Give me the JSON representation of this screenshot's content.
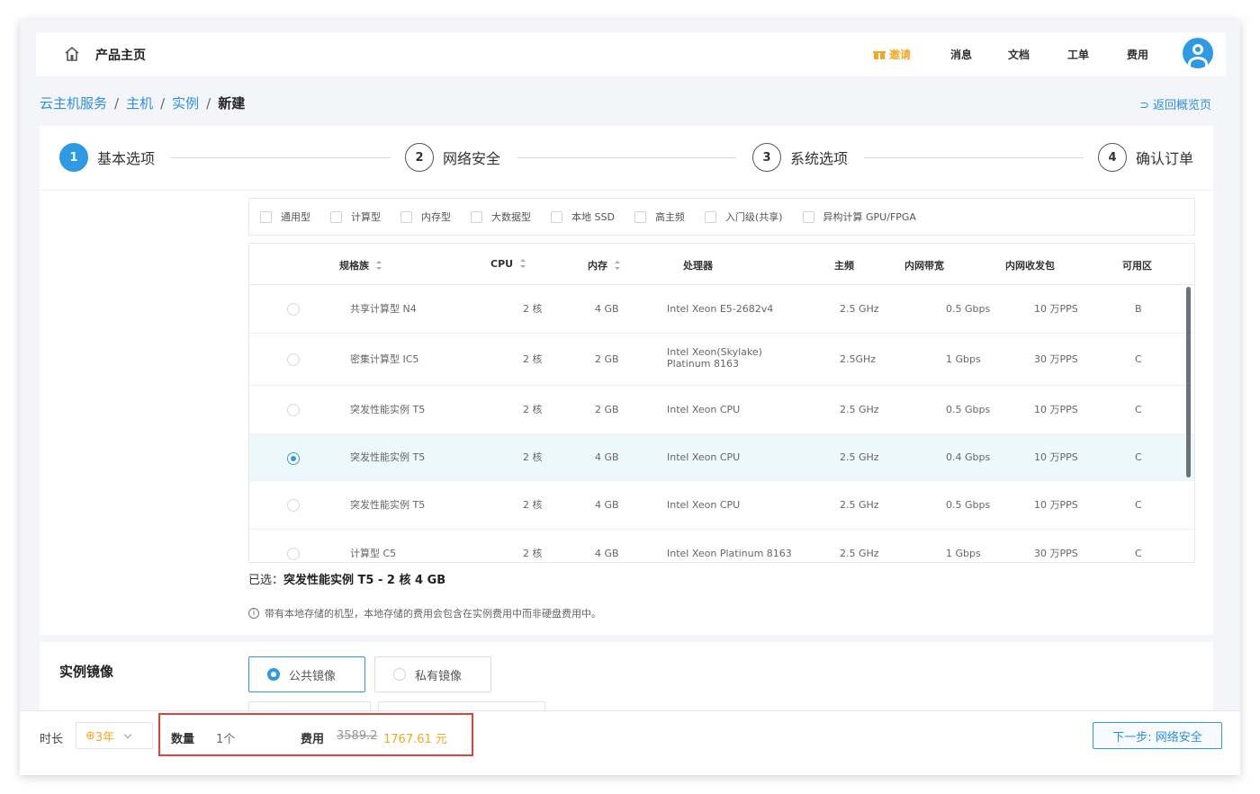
{
  "topnav": {
    "home_label": "产品主页",
    "promo_label": "邀请",
    "items": [
      "消息",
      "文档",
      "工单",
      "费用"
    ]
  },
  "breadcrumb": {
    "items": [
      "云主机服务",
      "主机",
      "实例"
    ],
    "current": "新建",
    "back_label": "返回概览页"
  },
  "steps": [
    {
      "num": "1",
      "label": "基本选项"
    },
    {
      "num": "2",
      "label": "网络安全"
    },
    {
      "num": "3",
      "label": "系统选项"
    },
    {
      "num": "4",
      "label": "确认订单"
    }
  ],
  "filters": [
    "通用型",
    "计算型",
    "内存型",
    "大数据型",
    "本地 SSD",
    "高主频",
    "入门级(共享)",
    "异构计算 GPU/FPGA"
  ],
  "table": {
    "columns": [
      "规格族",
      "CPU",
      "内存",
      "处理器",
      "主频",
      "内网带宽",
      "内网收发包",
      "可用区"
    ],
    "rows": [
      {
        "name": "共享计算型 N4",
        "cpu": "2 核",
        "mem": "4 GB",
        "proc": "Intel Xeon E5-2682v4",
        "freq": "2.5 GHz",
        "bw": "0.5 Gbps",
        "pps": "10 万PPS",
        "zone": "B"
      },
      {
        "name": "密集计算型 IC5",
        "cpu": "2 核",
        "mem": "2 GB",
        "proc": "Intel Xeon(Skylake) Platinum 8163",
        "freq": "2.5GHz",
        "bw": "1 Gbps",
        "pps": "30 万PPS",
        "zone": "C"
      },
      {
        "name": "突发性能实例 T5",
        "cpu": "2 核",
        "mem": "2 GB",
        "proc": "Intel Xeon CPU",
        "freq": "2.5 GHz",
        "bw": "0.5 Gbps",
        "pps": "10 万PPS",
        "zone": "C"
      },
      {
        "name": "突发性能实例 T5",
        "cpu": "2 核",
        "mem": "4 GB",
        "proc": "Intel Xeon CPU",
        "freq": "2.5 GHz",
        "bw": "0.4 Gbps",
        "pps": "10 万PPS",
        "zone": "C"
      },
      {
        "name": "突发性能实例 T5",
        "cpu": "2 核",
        "mem": "4 GB",
        "proc": "Intel Xeon CPU",
        "freq": "2.5 GHz",
        "bw": "0.5 Gbps",
        "pps": "10 万PPS",
        "zone": "C"
      },
      {
        "name": "计算型 C5",
        "cpu": "2 核",
        "mem": "4 GB",
        "proc": "Intel Xeon Platinum 8163",
        "freq": "2.5 GHz",
        "bw": "1 Gbps",
        "pps": "30 万PPS",
        "zone": "C"
      }
    ],
    "selected_index": 3
  },
  "selected": {
    "prefix": "已选：",
    "value": "突发性能实例 T5 - 2 核 4 GB"
  },
  "note": "带有本地存储的机型，本地存储的费用会包含在实例费用中而非硬盘费用中。",
  "image_section": {
    "title": "实例镜像",
    "options": [
      "公共镜像",
      "私有镜像"
    ]
  },
  "bottom": {
    "duration_label": "时长",
    "duration_value": "3年",
    "qty_label": "数量",
    "qty_value": "1个",
    "fee_label": "费用",
    "fee_old": "3589.2",
    "fee_new": "1767.61 元",
    "next_label": "下一步: 网络安全"
  },
  "colors": {
    "accent": "#2e9ae3",
    "price": "#f5a623",
    "highlight": "#e0413a"
  }
}
